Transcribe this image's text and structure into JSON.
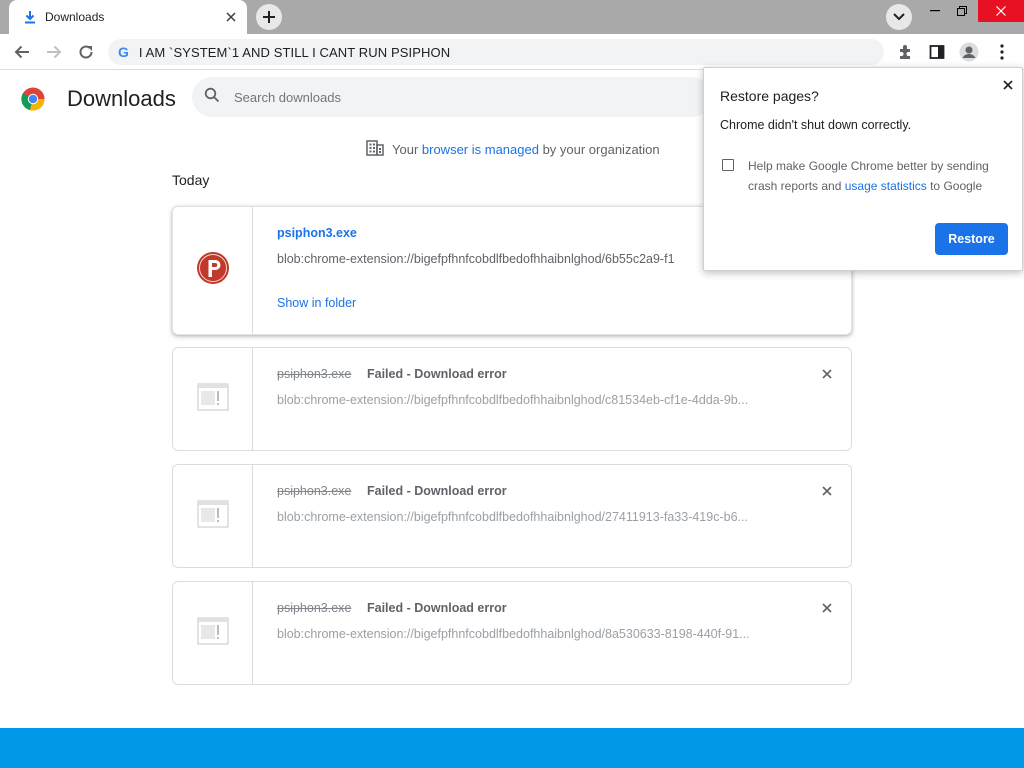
{
  "tab": {
    "title": "Downloads",
    "icon": "download-icon"
  },
  "toolbar": {
    "url": "I AM `SYSTEM`1 AND STILL I CANT RUN PSIPHON",
    "site_icon": "G"
  },
  "page": {
    "title": "Downloads",
    "search_placeholder": "Search downloads",
    "managed_prefix": "Your ",
    "managed_link": "browser is managed",
    "managed_suffix": " by your organization",
    "section": "Today"
  },
  "downloads": [
    {
      "name": "psiphon3.exe",
      "status": "",
      "source": "blob:chrome-extension://bigefpfhnfcobdlfbedofhhaibnlghod/6b55c2a9-f1",
      "action": "Show in folder"
    },
    {
      "name": "psiphon3.exe",
      "status": "Failed - Download error",
      "source": "blob:chrome-extension://bigefpfhnfcobdlfbedofhhaibnlghod/c81534eb-cf1e-4dda-9b..."
    },
    {
      "name": "psiphon3.exe",
      "status": "Failed - Download error",
      "source": "blob:chrome-extension://bigefpfhnfcobdlfbedofhhaibnlghod/27411913-fa33-419c-b6..."
    },
    {
      "name": "psiphon3.exe",
      "status": "Failed - Download error",
      "source": "blob:chrome-extension://bigefpfhnfcobdlfbedofhhaibnlghod/8a530633-8198-440f-91..."
    }
  ],
  "popup": {
    "title": "Restore pages?",
    "message": "Chrome didn't shut down correctly.",
    "checkbox_prefix": "Help make Google Chrome better by sending crash reports and ",
    "checkbox_link": "usage statistics",
    "checkbox_suffix": " to Google",
    "button": "Restore"
  },
  "colors": {
    "accent": "#1a73e8",
    "taskbar": "#0098e6",
    "tabstrip": "#a9a9a9",
    "psiphon": "#c0392b"
  }
}
